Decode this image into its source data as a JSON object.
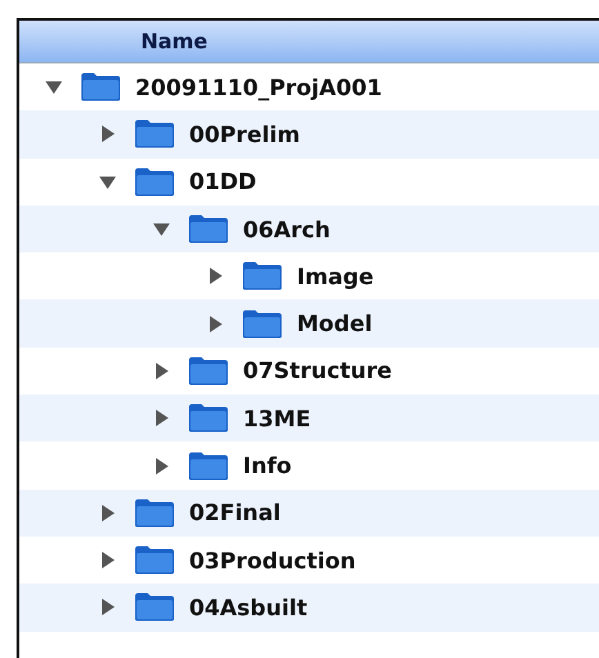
{
  "header": {
    "title": "Name"
  },
  "tree": [
    {
      "name": "20091110_ProjA001",
      "expanded": true,
      "children": [
        {
          "name": "00Prelim",
          "expanded": false
        },
        {
          "name": "01DD",
          "expanded": true,
          "children": [
            {
              "name": "06Arch",
              "expanded": true,
              "children": [
                {
                  "name": "Image",
                  "expanded": false
                },
                {
                  "name": "Model",
                  "expanded": false
                }
              ]
            },
            {
              "name": "07Structure",
              "expanded": false
            },
            {
              "name": "13ME",
              "expanded": false
            },
            {
              "name": "Info",
              "expanded": false
            }
          ]
        },
        {
          "name": "02Final",
          "expanded": false
        },
        {
          "name": "03Production",
          "expanded": false
        },
        {
          "name": "04Asbuilt",
          "expanded": false
        }
      ]
    }
  ]
}
